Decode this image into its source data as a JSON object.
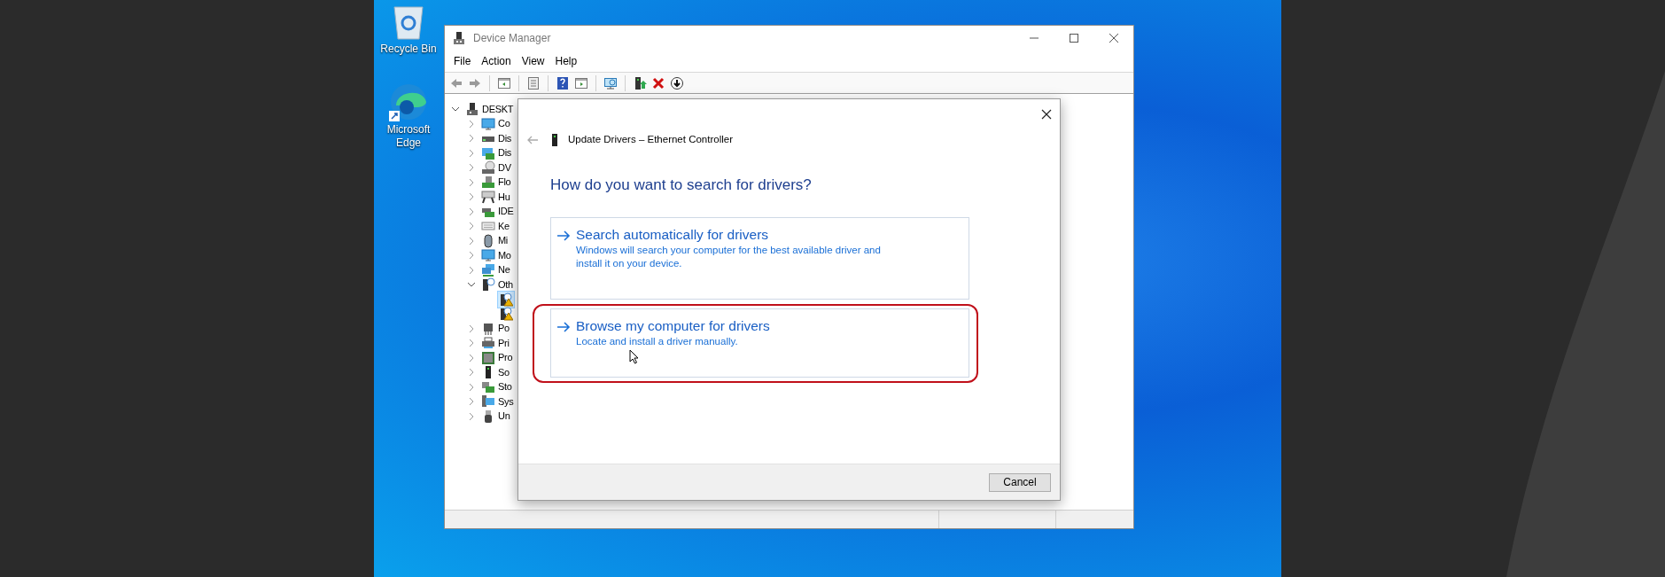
{
  "desktop_icons": [
    {
      "kind": "recycle",
      "label": "Recycle Bin"
    },
    {
      "kind": "edge",
      "label": "Microsoft Edge"
    }
  ],
  "window": {
    "title": "Device Manager",
    "menu": [
      "File",
      "Action",
      "View",
      "Help"
    ],
    "toolbar": [
      {
        "kind": "back"
      },
      {
        "kind": "forward"
      },
      {
        "kind": "sep"
      },
      {
        "kind": "tree"
      },
      {
        "kind": "sep"
      },
      {
        "kind": "properties"
      },
      {
        "kind": "sep"
      },
      {
        "kind": "help"
      },
      {
        "kind": "run"
      },
      {
        "kind": "sep"
      },
      {
        "kind": "scan"
      },
      {
        "kind": "sep"
      },
      {
        "kind": "update"
      },
      {
        "kind": "uninstall"
      },
      {
        "kind": "download"
      }
    ],
    "tree": [
      {
        "label": "DESKT",
        "expanded": true,
        "children": [
          {
            "label": "Co",
            "expanded": false
          },
          {
            "label": "Dis",
            "expanded": false
          },
          {
            "label": "Dis",
            "expanded": false
          },
          {
            "label": "DV",
            "expanded": false
          },
          {
            "label": "Flo",
            "expanded": false
          },
          {
            "label": "Hu",
            "expanded": false
          },
          {
            "label": "IDE",
            "expanded": false
          },
          {
            "label": "Ke",
            "expanded": false
          },
          {
            "label": "Mi",
            "expanded": false
          },
          {
            "label": "Mo",
            "expanded": false
          },
          {
            "label": "Ne",
            "expanded": false
          },
          {
            "label": "Oth",
            "expanded": true,
            "children": [
              {
                "selected": true
              },
              {
                "selected": false
              }
            ]
          },
          {
            "label": "Po",
            "expanded": false
          },
          {
            "label": "Pri",
            "expanded": false
          },
          {
            "label": "Pro",
            "expanded": false
          },
          {
            "label": "So",
            "expanded": false
          },
          {
            "label": "Sto",
            "expanded": false
          },
          {
            "label": "Sys",
            "expanded": false
          },
          {
            "label": "Un",
            "expanded": false
          }
        ]
      }
    ]
  },
  "dialog": {
    "title": "Update Drivers – Ethernet Controller",
    "heading": "How do you want to search for drivers?",
    "options": [
      {
        "title": "Search automatically for drivers",
        "description": "Windows will search your computer for the best available driver and install it on your device.",
        "highlighted": false
      },
      {
        "title": "Browse my computer for drivers",
        "description": "Locate and install a driver manually.",
        "highlighted": true
      }
    ],
    "buttons": [
      "Cancel"
    ]
  }
}
